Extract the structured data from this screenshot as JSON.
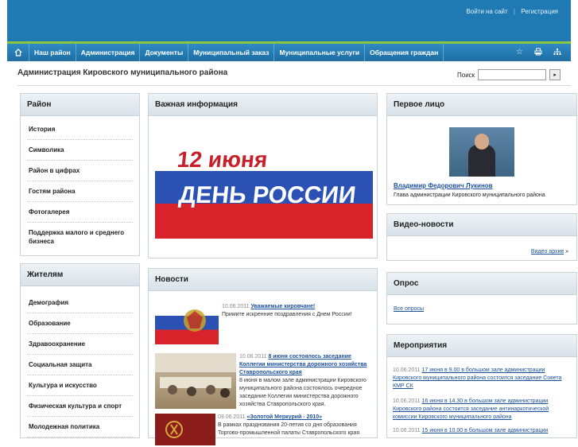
{
  "top": {
    "login": "Войти на сайт",
    "register": "Регистрация"
  },
  "nav": {
    "items": [
      {
        "label": "Наш район"
      },
      {
        "label": "Администрация"
      },
      {
        "label": "Документы"
      },
      {
        "label": "Муниципальный заказ"
      },
      {
        "label": "Муниципальные услуги"
      },
      {
        "label": "Обращения граждан"
      }
    ],
    "icons": [
      "home-icon",
      "star-icon",
      "print-icon",
      "sitemap-icon"
    ]
  },
  "header": {
    "title": "Администрация Кировского муниципального района",
    "search_label": "Поиск",
    "search_value": ""
  },
  "left": {
    "rayon": {
      "title": "Район",
      "items": [
        "История",
        "Символика",
        "Район в цифрах",
        "Гостям района",
        "Фотогалерея",
        "Поддержка малого и среднего бизнеса"
      ]
    },
    "residents": {
      "title": "Жителям",
      "items": [
        "Демография",
        "Образование",
        "Здравоохранение",
        "Социальная защита",
        "Культура и искусство",
        "Физическая культура и спорт",
        "Молодежная политика"
      ]
    }
  },
  "middle": {
    "important": {
      "title": "Важная информация",
      "banner_line1": "12 июня",
      "banner_line2": "ДЕНЬ РОССИИ"
    },
    "news": {
      "title": "Новости",
      "items": [
        {
          "date": "10.06.2011",
          "title": "Уважаемые кировчане!",
          "text": "Примите искренние поздравления с Днем России!"
        },
        {
          "date": "10.06.2011",
          "title": "8 июня состоялось заседание Коллегии министерства дорожного хозяйства Ставропольского края",
          "text": "8 июня в малом зале администрации Кировского муниципального района состоялось очередное заседание Коллегии министерства дорожного хозяйства Ставропольского края."
        },
        {
          "date": "09.06.2011",
          "title": "«Золотой Меркурий - 2010»",
          "text": "В рамках празднования 20-летия со дня образования Торгово-промышленной палаты Ставропольского края"
        }
      ]
    }
  },
  "right": {
    "person": {
      "title": "Первое лицо",
      "name": "Владимир Федорович Лукинов",
      "role": "Глава администрации Кировского муниципального района"
    },
    "video": {
      "title": "Видео-новости",
      "archive": "Видео архив",
      "arrow": "»"
    },
    "poll": {
      "title": "Опрос",
      "all": "Все опросы"
    },
    "events": {
      "title": "Мероприятия",
      "items": [
        {
          "date": "10.06.2011",
          "text": "17 июня в 9.00 в большом зале администрации Кировского муниципального района состоится заседание Совета КМР СК"
        },
        {
          "date": "10.06.2011",
          "text": "16 июня в 14.30 в большом зале администрации Кировского района состоится заседание антинаркотической комиссии Кировского муниципального района"
        },
        {
          "date": "10.06.2011",
          "text": "15 июня в 10.00 в большом зале администрации"
        }
      ]
    }
  }
}
